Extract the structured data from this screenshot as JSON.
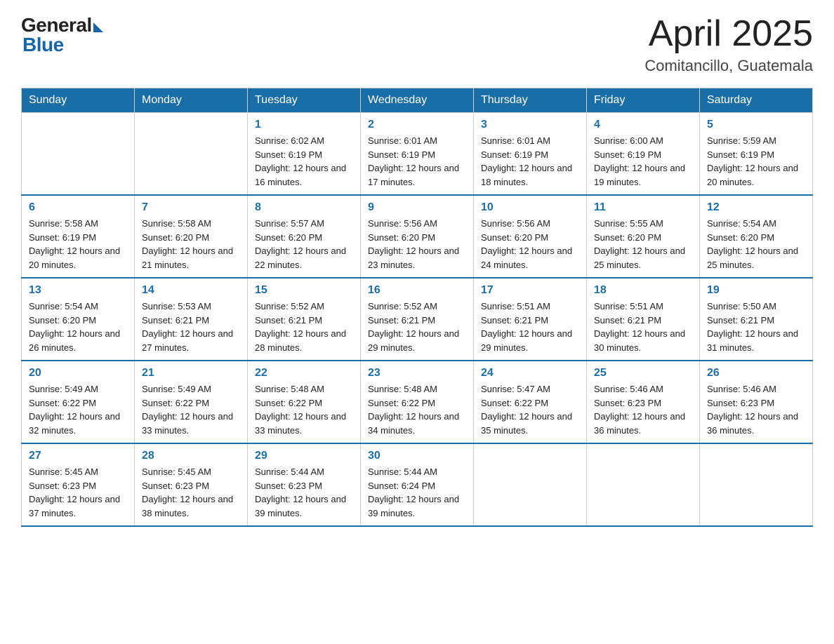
{
  "logo": {
    "general": "General",
    "blue": "Blue"
  },
  "title": "April 2025",
  "subtitle": "Comitancillo, Guatemala",
  "weekdays": [
    "Sunday",
    "Monday",
    "Tuesday",
    "Wednesday",
    "Thursday",
    "Friday",
    "Saturday"
  ],
  "weeks": [
    [
      {
        "day": "",
        "sunrise": "",
        "sunset": "",
        "daylight": ""
      },
      {
        "day": "",
        "sunrise": "",
        "sunset": "",
        "daylight": ""
      },
      {
        "day": "1",
        "sunrise": "Sunrise: 6:02 AM",
        "sunset": "Sunset: 6:19 PM",
        "daylight": "Daylight: 12 hours and 16 minutes."
      },
      {
        "day": "2",
        "sunrise": "Sunrise: 6:01 AM",
        "sunset": "Sunset: 6:19 PM",
        "daylight": "Daylight: 12 hours and 17 minutes."
      },
      {
        "day": "3",
        "sunrise": "Sunrise: 6:01 AM",
        "sunset": "Sunset: 6:19 PM",
        "daylight": "Daylight: 12 hours and 18 minutes."
      },
      {
        "day": "4",
        "sunrise": "Sunrise: 6:00 AM",
        "sunset": "Sunset: 6:19 PM",
        "daylight": "Daylight: 12 hours and 19 minutes."
      },
      {
        "day": "5",
        "sunrise": "Sunrise: 5:59 AM",
        "sunset": "Sunset: 6:19 PM",
        "daylight": "Daylight: 12 hours and 20 minutes."
      }
    ],
    [
      {
        "day": "6",
        "sunrise": "Sunrise: 5:58 AM",
        "sunset": "Sunset: 6:19 PM",
        "daylight": "Daylight: 12 hours and 20 minutes."
      },
      {
        "day": "7",
        "sunrise": "Sunrise: 5:58 AM",
        "sunset": "Sunset: 6:20 PM",
        "daylight": "Daylight: 12 hours and 21 minutes."
      },
      {
        "day": "8",
        "sunrise": "Sunrise: 5:57 AM",
        "sunset": "Sunset: 6:20 PM",
        "daylight": "Daylight: 12 hours and 22 minutes."
      },
      {
        "day": "9",
        "sunrise": "Sunrise: 5:56 AM",
        "sunset": "Sunset: 6:20 PM",
        "daylight": "Daylight: 12 hours and 23 minutes."
      },
      {
        "day": "10",
        "sunrise": "Sunrise: 5:56 AM",
        "sunset": "Sunset: 6:20 PM",
        "daylight": "Daylight: 12 hours and 24 minutes."
      },
      {
        "day": "11",
        "sunrise": "Sunrise: 5:55 AM",
        "sunset": "Sunset: 6:20 PM",
        "daylight": "Daylight: 12 hours and 25 minutes."
      },
      {
        "day": "12",
        "sunrise": "Sunrise: 5:54 AM",
        "sunset": "Sunset: 6:20 PM",
        "daylight": "Daylight: 12 hours and 25 minutes."
      }
    ],
    [
      {
        "day": "13",
        "sunrise": "Sunrise: 5:54 AM",
        "sunset": "Sunset: 6:20 PM",
        "daylight": "Daylight: 12 hours and 26 minutes."
      },
      {
        "day": "14",
        "sunrise": "Sunrise: 5:53 AM",
        "sunset": "Sunset: 6:21 PM",
        "daylight": "Daylight: 12 hours and 27 minutes."
      },
      {
        "day": "15",
        "sunrise": "Sunrise: 5:52 AM",
        "sunset": "Sunset: 6:21 PM",
        "daylight": "Daylight: 12 hours and 28 minutes."
      },
      {
        "day": "16",
        "sunrise": "Sunrise: 5:52 AM",
        "sunset": "Sunset: 6:21 PM",
        "daylight": "Daylight: 12 hours and 29 minutes."
      },
      {
        "day": "17",
        "sunrise": "Sunrise: 5:51 AM",
        "sunset": "Sunset: 6:21 PM",
        "daylight": "Daylight: 12 hours and 29 minutes."
      },
      {
        "day": "18",
        "sunrise": "Sunrise: 5:51 AM",
        "sunset": "Sunset: 6:21 PM",
        "daylight": "Daylight: 12 hours and 30 minutes."
      },
      {
        "day": "19",
        "sunrise": "Sunrise: 5:50 AM",
        "sunset": "Sunset: 6:21 PM",
        "daylight": "Daylight: 12 hours and 31 minutes."
      }
    ],
    [
      {
        "day": "20",
        "sunrise": "Sunrise: 5:49 AM",
        "sunset": "Sunset: 6:22 PM",
        "daylight": "Daylight: 12 hours and 32 minutes."
      },
      {
        "day": "21",
        "sunrise": "Sunrise: 5:49 AM",
        "sunset": "Sunset: 6:22 PM",
        "daylight": "Daylight: 12 hours and 33 minutes."
      },
      {
        "day": "22",
        "sunrise": "Sunrise: 5:48 AM",
        "sunset": "Sunset: 6:22 PM",
        "daylight": "Daylight: 12 hours and 33 minutes."
      },
      {
        "day": "23",
        "sunrise": "Sunrise: 5:48 AM",
        "sunset": "Sunset: 6:22 PM",
        "daylight": "Daylight: 12 hours and 34 minutes."
      },
      {
        "day": "24",
        "sunrise": "Sunrise: 5:47 AM",
        "sunset": "Sunset: 6:22 PM",
        "daylight": "Daylight: 12 hours and 35 minutes."
      },
      {
        "day": "25",
        "sunrise": "Sunrise: 5:46 AM",
        "sunset": "Sunset: 6:23 PM",
        "daylight": "Daylight: 12 hours and 36 minutes."
      },
      {
        "day": "26",
        "sunrise": "Sunrise: 5:46 AM",
        "sunset": "Sunset: 6:23 PM",
        "daylight": "Daylight: 12 hours and 36 minutes."
      }
    ],
    [
      {
        "day": "27",
        "sunrise": "Sunrise: 5:45 AM",
        "sunset": "Sunset: 6:23 PM",
        "daylight": "Daylight: 12 hours and 37 minutes."
      },
      {
        "day": "28",
        "sunrise": "Sunrise: 5:45 AM",
        "sunset": "Sunset: 6:23 PM",
        "daylight": "Daylight: 12 hours and 38 minutes."
      },
      {
        "day": "29",
        "sunrise": "Sunrise: 5:44 AM",
        "sunset": "Sunset: 6:23 PM",
        "daylight": "Daylight: 12 hours and 39 minutes."
      },
      {
        "day": "30",
        "sunrise": "Sunrise: 5:44 AM",
        "sunset": "Sunset: 6:24 PM",
        "daylight": "Daylight: 12 hours and 39 minutes."
      },
      {
        "day": "",
        "sunrise": "",
        "sunset": "",
        "daylight": ""
      },
      {
        "day": "",
        "sunrise": "",
        "sunset": "",
        "daylight": ""
      },
      {
        "day": "",
        "sunrise": "",
        "sunset": "",
        "daylight": ""
      }
    ]
  ]
}
